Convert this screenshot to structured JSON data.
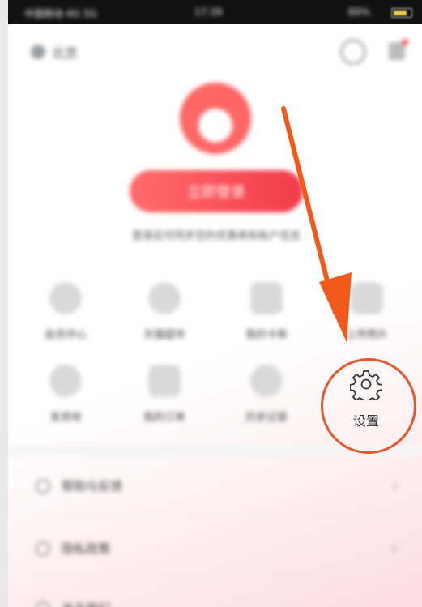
{
  "status_bar": {
    "carrier": "中国移动 4G 5G",
    "time": "17:39",
    "battery": "89%"
  },
  "header": {
    "location": "北京",
    "message_icon": "message-icon",
    "more_icon": "more-icon"
  },
  "profile": {
    "login_button": "立即登录",
    "login_hint": "登录后可同步您的优惠券和账户信息"
  },
  "grid": [
    {
      "label": "会员中心",
      "icon": "shield-icon"
    },
    {
      "label": "天猫超市",
      "icon": "cloud-icon"
    },
    {
      "label": "我的卡券",
      "icon": "gift-icon"
    },
    {
      "label": "上传照片",
      "icon": "photo-icon"
    },
    {
      "label": "发货地",
      "icon": "map-icon"
    },
    {
      "label": "我的订单",
      "icon": "order-icon"
    },
    {
      "label": "历史记录",
      "icon": "clock-icon"
    }
  ],
  "settings": {
    "label": "设置",
    "icon": "gear-icon"
  },
  "list": [
    {
      "label": "帮助与反馈",
      "icon": "help-icon"
    },
    {
      "label": "隐私政策",
      "icon": "privacy-icon"
    },
    {
      "label": "关于我们",
      "icon": "about-icon"
    }
  ],
  "colors": {
    "accent_red": "#f23b4a",
    "annotation": "#e2582c"
  }
}
